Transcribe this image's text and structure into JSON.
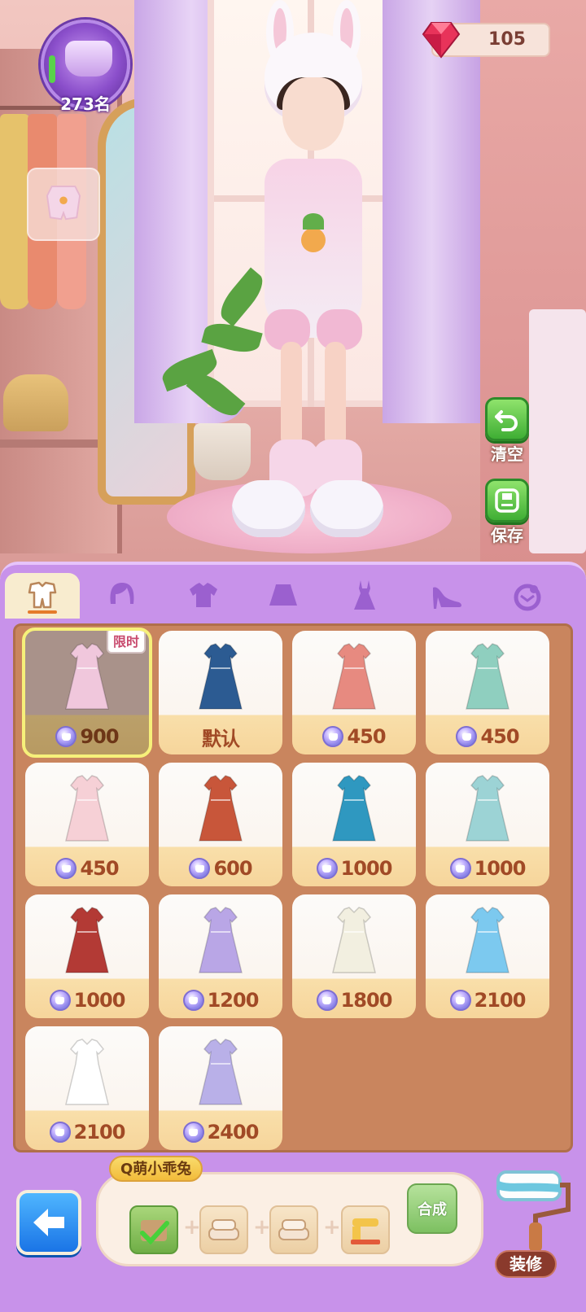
{
  "hud": {
    "rank": "273名",
    "gems": "105"
  },
  "side_buttons": {
    "clear_label": "清空",
    "save_label": "保存"
  },
  "tabs": [
    {
      "name": "outfit-set",
      "icon": "outfit-icon",
      "active": true
    },
    {
      "name": "hair",
      "icon": "hair-icon",
      "active": false
    },
    {
      "name": "top",
      "icon": "shirt-icon",
      "active": false
    },
    {
      "name": "skirt",
      "icon": "skirt-icon",
      "active": false
    },
    {
      "name": "dress",
      "icon": "dress-icon",
      "active": false
    },
    {
      "name": "shoes",
      "icon": "heels-icon",
      "active": false
    },
    {
      "name": "accessory",
      "icon": "accessory-icon",
      "active": false
    }
  ],
  "items": [
    {
      "price": "900",
      "tag": "限时",
      "selected": true,
      "color": "#f0c7dc"
    },
    {
      "price": "默认",
      "selected": false,
      "color": "#2c5b92"
    },
    {
      "price": "450",
      "selected": false,
      "color": "#e78a80"
    },
    {
      "price": "450",
      "selected": false,
      "color": "#8fcfbf"
    },
    {
      "price": "450",
      "selected": false,
      "color": "#f6d0d6"
    },
    {
      "price": "600",
      "selected": false,
      "color": "#c8563a"
    },
    {
      "price": "1000",
      "selected": false,
      "color": "#2f98c0"
    },
    {
      "price": "1000",
      "selected": false,
      "color": "#9cd3d5"
    },
    {
      "price": "1000",
      "selected": false,
      "color": "#b33a35"
    },
    {
      "price": "1200",
      "selected": false,
      "color": "#b9a6e6"
    },
    {
      "price": "1800",
      "selected": false,
      "color": "#f2efe0"
    },
    {
      "price": "2100",
      "selected": false,
      "color": "#7cc9ef"
    },
    {
      "price": "2100",
      "selected": false,
      "color": "#ffffff"
    },
    {
      "price": "2400",
      "selected": false,
      "color": "#b9b0e8"
    }
  ],
  "craft": {
    "set_name": "Q萌小乖兔",
    "craft_label": "合成"
  },
  "decor_label": "装修",
  "colors": {
    "panel": "#c892ea",
    "grid_bg": "#c9855e",
    "price_text": "#a14a26",
    "green_button": "#3fae34"
  }
}
